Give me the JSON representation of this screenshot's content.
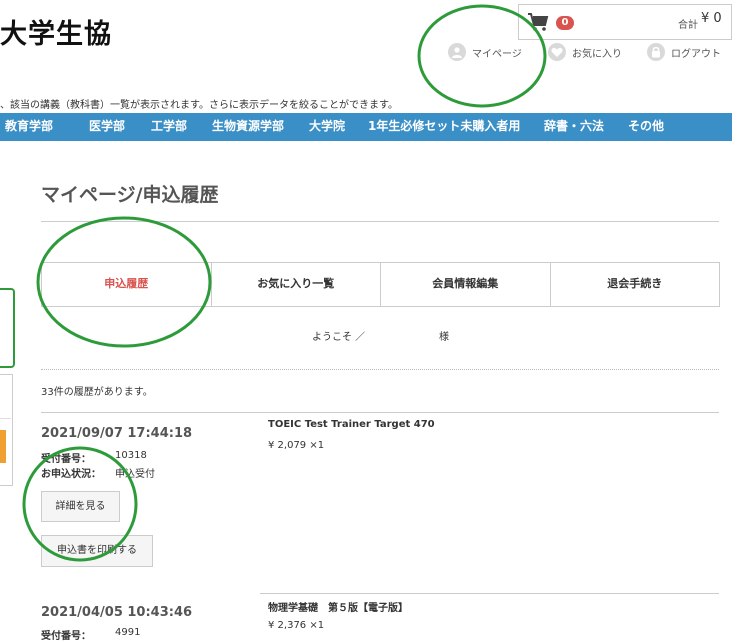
{
  "header": {
    "site_name": "大学生協",
    "cart": {
      "count": "0",
      "total_label": "合計",
      "total_value": "¥ 0"
    },
    "links": {
      "mypage": "マイページ",
      "favorites": "お気に入り",
      "logout": "ログアウト"
    }
  },
  "description": "、該当の講義（教科書）一覧が表示されます。さらに表示データを絞ることができます。",
  "nav": {
    "items": [
      "教育学部",
      "医学部",
      "工学部",
      "生物資源学部",
      "大学院",
      "1年生必修セット未購入者用",
      "辞書・六法",
      "その他"
    ]
  },
  "page_title": "マイページ/申込履歴",
  "tabs": [
    "申込履歴",
    "お気に入り一覧",
    "会員情報編集",
    "退会手続き"
  ],
  "welcome": {
    "prefix": "ようこそ ／",
    "suffix": "様"
  },
  "history_count": "33件の履歴があります。",
  "orders": [
    {
      "date": "2021/09/07 17:44:18",
      "reception_label": "受付番号：",
      "reception_no": "10318",
      "status_label": "お申込状況：",
      "status": "申込受付",
      "title": "TOEIC Test Trainer Target 470",
      "price": "¥ 2,079 ×1",
      "detail_button": "詳細を見る",
      "print_button": "申込書を印刷する"
    },
    {
      "date": "2021/04/05 10:43:46",
      "reception_label": "受付番号：",
      "reception_no": "4991",
      "title": "物理学基礎　第５版【電子版】",
      "price": "¥ 2,376 ×1"
    }
  ],
  "colors": {
    "nav_bg": "#3a8fc7",
    "active_tab": "#d9534f",
    "annotation": "#2e9b3b",
    "cart_badge": "#d9534f"
  },
  "icons": [
    "cart-icon",
    "user-icon",
    "heart-icon",
    "lock-icon"
  ]
}
